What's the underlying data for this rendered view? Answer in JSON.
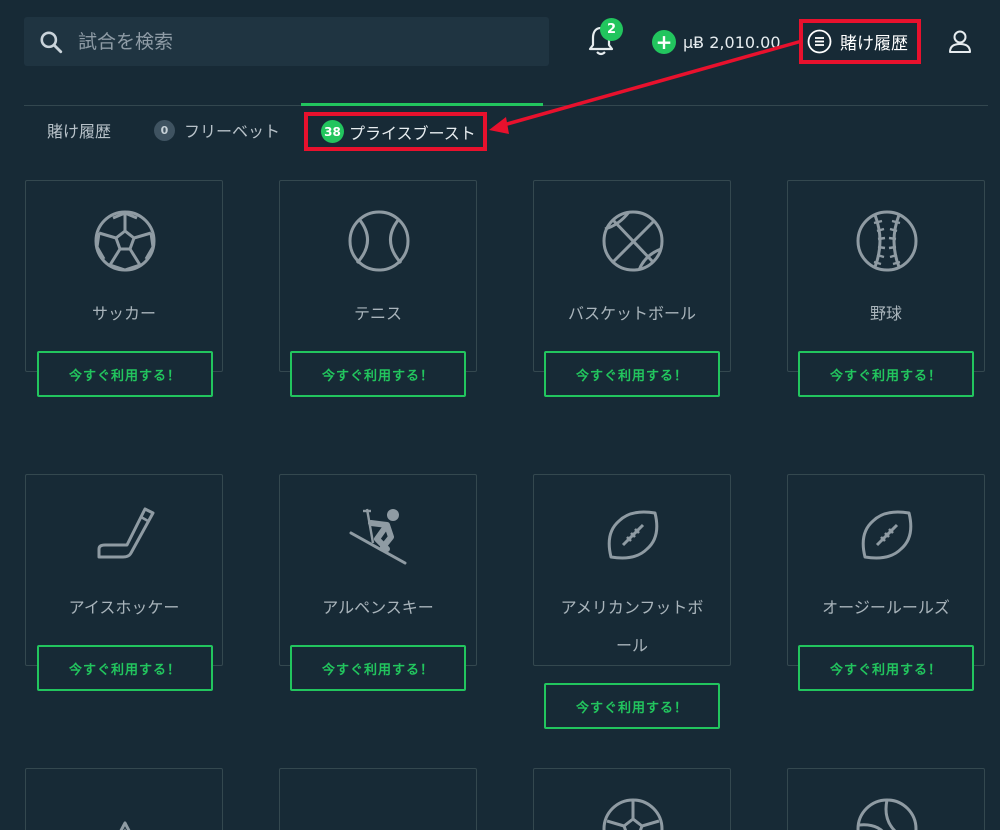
{
  "search": {
    "placeholder": "試合を検索"
  },
  "notifications": {
    "count": "2"
  },
  "balance": {
    "plus": "+",
    "amount": "µɃ 2,010.00"
  },
  "header": {
    "history_label": "賭け履歴"
  },
  "tabs": [
    {
      "label": "賭け履歴"
    },
    {
      "label": "フリーベット",
      "count": "0"
    },
    {
      "label": "プライスブースト",
      "count": "38"
    }
  ],
  "cta_label": "今すぐ利用する！",
  "sports": [
    {
      "name": "サッカー",
      "icon": "soccer-ball-icon"
    },
    {
      "name": "テニス",
      "icon": "tennis-ball-icon"
    },
    {
      "name": "バスケットボール",
      "icon": "basketball-icon"
    },
    {
      "name": "野球",
      "icon": "baseball-icon"
    },
    {
      "name": "アイスホッケー",
      "icon": "hockey-stick-icon"
    },
    {
      "name": "アルペンスキー",
      "icon": "skier-icon"
    },
    {
      "name": "アメリカンフットボ",
      "name2": "ール",
      "icon": "american-football-icon"
    },
    {
      "name": "オージールールズ",
      "icon": "rugby-ball-icon"
    }
  ],
  "colors": {
    "accent": "#22c55e",
    "background": "#172a36",
    "annotation": "#e8112d"
  }
}
